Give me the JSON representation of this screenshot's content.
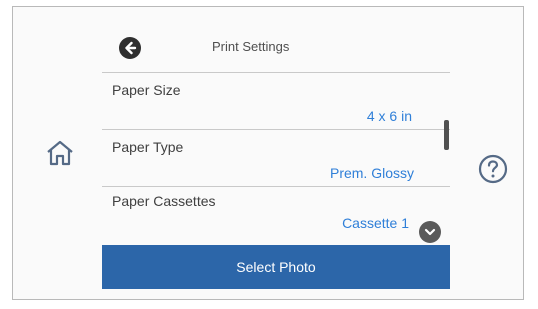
{
  "header": {
    "title": "Print Settings"
  },
  "settings": [
    {
      "label": "Paper Size",
      "value": "4 x 6 in"
    },
    {
      "label": "Paper Type",
      "value": "Prem. Glossy"
    },
    {
      "label": "Paper Cassettes",
      "value": "Cassette 1"
    }
  ],
  "footer": {
    "action_label": "Select Photo"
  },
  "icons": {
    "back": "back-arrow-icon",
    "home": "home-icon",
    "help": "help-icon",
    "scroll_down": "chevron-down-icon"
  },
  "colors": {
    "accent": "#2f7fd8",
    "primary_button": "#2c66a9"
  }
}
